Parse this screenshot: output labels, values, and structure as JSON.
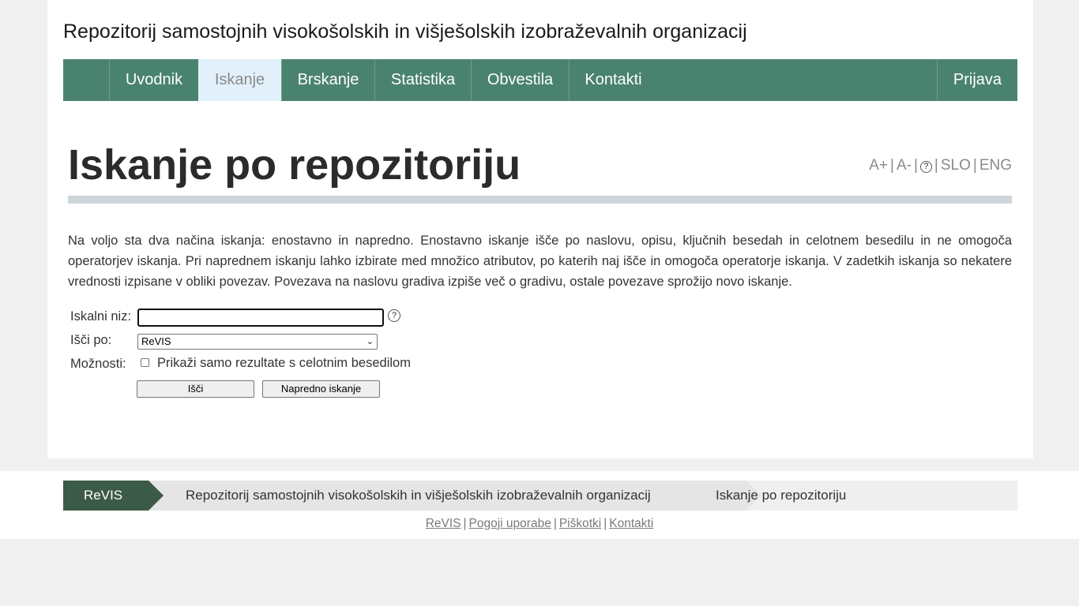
{
  "site_title": "Repozitorij samostojnih visokošolskih in višješolskih izobraževalnih organizacij",
  "nav": {
    "items": [
      "Uvodnik",
      "Iskanje",
      "Brskanje",
      "Statistika",
      "Obvestila",
      "Kontakti"
    ],
    "active": "Iskanje",
    "login": "Prijava"
  },
  "page_title": "Iskanje po repozitoriju",
  "tools": {
    "font_up": "A+",
    "font_down": "A-",
    "help": "?",
    "lang_slo": "SLO",
    "lang_eng": "ENG",
    "separator": "|"
  },
  "intro": "Na voljo sta dva načina iskanja: enostavno in napredno. Enostavno iskanje išče po naslovu, opisu, ključnih besedah in celotnem besedilu in ne omogoča operatorjev iskanja. Pri naprednem iskanju lahko izbirate med množico atributov, po katerih naj išče in omogoča operatorje iskanja. V zadetkih iskanja so nekatere vrednosti izpisane v obliki povezav. Povezava na naslovu gradiva izpiše več o gradivu, ostale povezave sprožijo novo iskanje.",
  "form": {
    "query_label": "Iskalni niz:",
    "query_value": "",
    "query_help": "?",
    "search_by_label": "Išči po:",
    "search_by_value": "ReVIS",
    "options_label": "Možnosti:",
    "fulltext_label": "Prikaži samo rezultate s celotnim besedilom",
    "fulltext_checked": false,
    "search_button": "Išči",
    "advanced_button": "Napredno iskanje"
  },
  "footer": {
    "breadcrumb": [
      "ReVIS",
      "Repozitorij samostojnih visokošolskih in višješolskih izobraževalnih organizacij",
      "Iskanje po repozitoriju"
    ],
    "links": [
      "ReVIS",
      "Pogoji uporabe",
      "Piškotki",
      "Kontakti"
    ],
    "separator": "|"
  },
  "colors": {
    "nav_bg": "#4a8270",
    "nav_active_bg": "#e2f0fb",
    "breadcrumb_home_bg": "#3c5a48",
    "rule": "#cdd5d8"
  }
}
